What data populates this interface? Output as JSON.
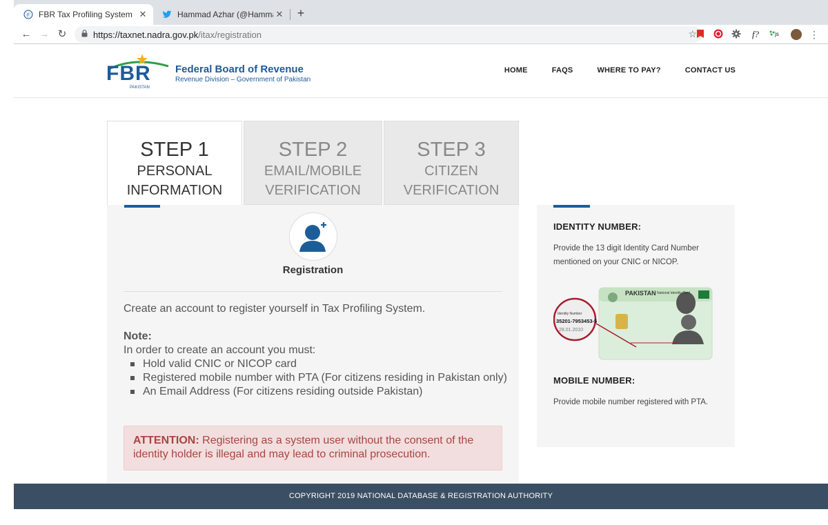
{
  "browser": {
    "tabs": [
      {
        "title": "FBR Tax Profiling System",
        "active": true
      },
      {
        "title": "Hammad Azhar (@Hammad_Az",
        "active": false
      }
    ],
    "url_host": "https://taxnet.nadra.gov.pk",
    "url_path": "/itax/registration",
    "new_tab": "+",
    "extensions": [
      "f?",
      "js"
    ]
  },
  "header": {
    "logo_abbr": "FBR",
    "logo_country": "PAKISTAN",
    "logo_title": "Federal Board of Revenue",
    "logo_subtitle": "Revenue Division – Government of Pakistan",
    "nav": [
      "HOME",
      "FAQS",
      "WHERE TO PAY?",
      "CONTACT US"
    ]
  },
  "steps": [
    {
      "number": "STEP 1",
      "label": "PERSONAL\nINFORMATION",
      "active": true
    },
    {
      "number": "STEP 2",
      "label": "EMAIL/MOBILE\nVERIFICATION",
      "active": false
    },
    {
      "number": "STEP 3",
      "label": "CITIZEN\nVERIFICATION",
      "active": false
    }
  ],
  "main": {
    "title": "Registration",
    "intro": "Create an account to register yourself in Tax Profiling System.",
    "note_label": "Note:",
    "note_text": "In order to create an account you must:",
    "requirements": [
      "Hold valid CNIC or NICOP card",
      "Registered mobile number with PTA (For citizens residing in Pakistan only)",
      "An Email Address (For citizens residing outside Pakistan)"
    ],
    "attention_label": "ATTENTION:",
    "attention_text": " Registering as a system user without the consent of the identity holder is illegal and may lead to criminal prosecution."
  },
  "sidebar": {
    "identity_title": "IDENTITY NUMBER:",
    "identity_text": "Provide the 13 digit Identity Card Number mentioned on your CNIC or NICOP.",
    "card_country": "PAKISTAN",
    "card_sub": "National Identity Card",
    "card_id_label": "Identity Number",
    "card_id": "35201-7953453-5",
    "card_date": "28.01.2010",
    "mobile_title": "MOBILE NUMBER:",
    "mobile_text": "Provide mobile number registered with PTA."
  },
  "footer": {
    "copyright": "COPYRIGHT 2019 NATIONAL DATABASE & REGISTRATION AUTHORITY"
  },
  "colors": {
    "brand_blue": "#1c5d99",
    "footer_bg": "#3b4f64",
    "alert_bg": "#f2dede",
    "alert_text": "#a94442"
  }
}
